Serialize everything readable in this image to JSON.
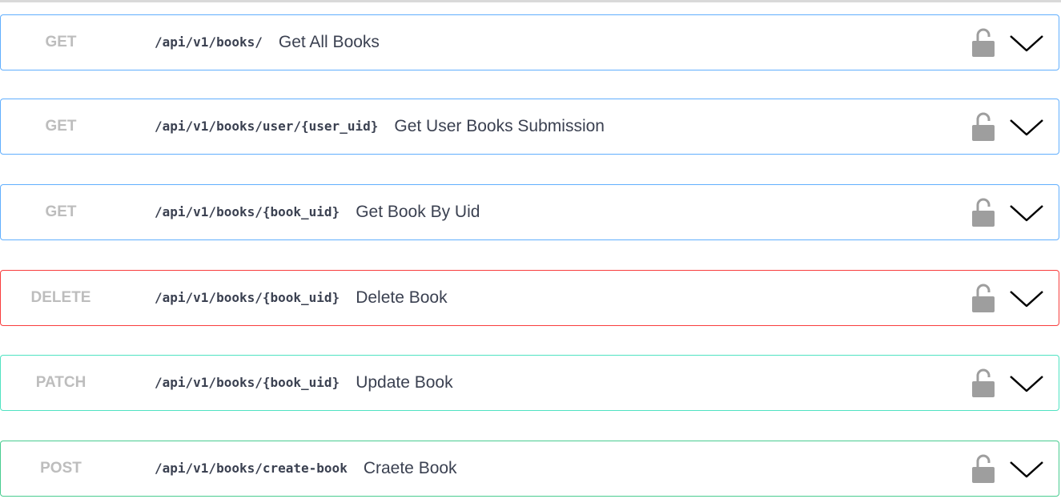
{
  "operations": [
    {
      "method": "GET",
      "kind": "get",
      "path": "/api/v1/books/",
      "summary": "Get All Books",
      "lock_icon": "unlock-icon",
      "expand_icon": "chevron-down-icon"
    },
    {
      "method": "GET",
      "kind": "get",
      "path": "/api/v1/books/user/{user_uid}",
      "summary": "Get User Books Submission",
      "lock_icon": "unlock-icon",
      "expand_icon": "chevron-down-icon"
    },
    {
      "method": "GET",
      "kind": "get",
      "path": "/api/v1/books/{book_uid}",
      "summary": "Get Book By Uid",
      "lock_icon": "unlock-icon",
      "expand_icon": "chevron-down-icon"
    },
    {
      "method": "DELETE",
      "kind": "delete",
      "path": "/api/v1/books/{book_uid}",
      "summary": "Delete Book",
      "lock_icon": "unlock-icon",
      "expand_icon": "chevron-down-icon"
    },
    {
      "method": "PATCH",
      "kind": "patch",
      "path": "/api/v1/books/{book_uid}",
      "summary": "Update Book",
      "lock_icon": "unlock-icon",
      "expand_icon": "chevron-down-icon"
    },
    {
      "method": "POST",
      "kind": "post",
      "path": "/api/v1/books/create-book",
      "summary": "Craete Book",
      "lock_icon": "unlock-icon",
      "expand_icon": "chevron-down-icon"
    }
  ],
  "colors": {
    "get": "#61affe",
    "delete": "#f93e3e",
    "patch": "#50e3c2",
    "post": "#49cc90",
    "method_text": "#bdbdbd",
    "text": "#3b4151",
    "icon": "#9e9e9e"
  }
}
